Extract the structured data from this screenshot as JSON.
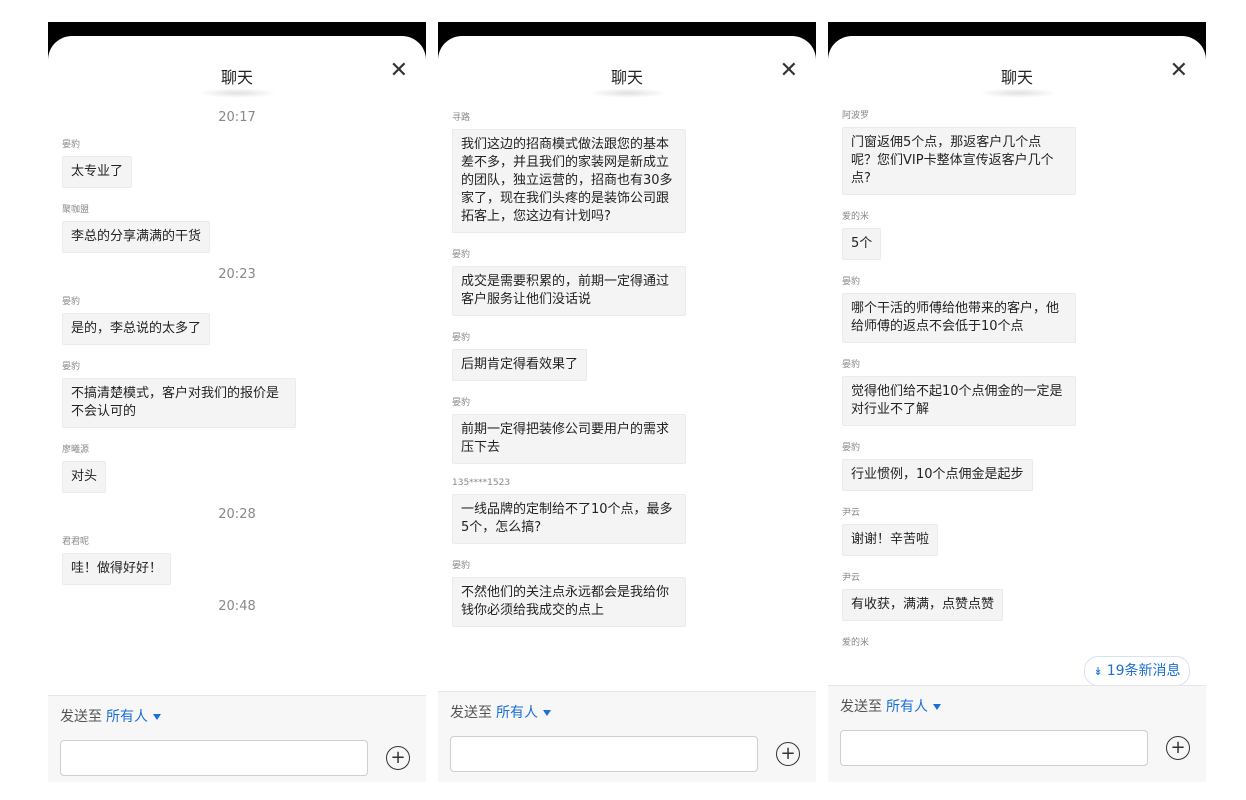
{
  "panels": [
    {
      "title": "聊天",
      "close": "✕",
      "items": [
        {
          "type": "time",
          "text": "20:17"
        },
        {
          "type": "msg",
          "sender": "晏豹",
          "text": "太专业了"
        },
        {
          "type": "msg",
          "sender": "聚咖盟",
          "text": "李总的分享满满的干货"
        },
        {
          "type": "time",
          "text": "20:23"
        },
        {
          "type": "msg",
          "sender": "晏豹",
          "text": "是的，李总说的太多了"
        },
        {
          "type": "msg",
          "sender": "晏豹",
          "text": "不搞清楚模式，客户对我们的报价是不会认可的"
        },
        {
          "type": "msg",
          "sender": "廖曦源",
          "text": "对头"
        },
        {
          "type": "time",
          "text": "20:28"
        },
        {
          "type": "msg",
          "sender": "君君呢",
          "text": "哇！做得好好！"
        },
        {
          "type": "time",
          "text": "20:48"
        }
      ],
      "send_to_label": "发送至",
      "recipient": "所有人",
      "plus": "+"
    },
    {
      "title": "聊天",
      "close": "✕",
      "items": [
        {
          "type": "msg",
          "sender": "寻路",
          "text": "我们这边的招商模式做法跟您的基本差不多，并且我们的家装网是新成立的团队，独立运营的，招商也有30多家了，现在我们头疼的是装饰公司跟拓客上，您这边有计划吗?"
        },
        {
          "type": "msg",
          "sender": "晏豹",
          "text": "成交是需要积累的，前期一定得通过客户服务让他们没话说"
        },
        {
          "type": "msg",
          "sender": "晏豹",
          "text": "后期肯定得看效果了"
        },
        {
          "type": "msg",
          "sender": "晏豹",
          "text": "前期一定得把装修公司要用户的需求压下去"
        },
        {
          "type": "msg",
          "sender": "135****1523",
          "text": "一线品牌的定制给不了10个点，最多5个，怎么搞?"
        },
        {
          "type": "msg",
          "sender": "晏豹",
          "text": "不然他们的关注点永远都会是我给你钱你必须给我成交的点上"
        }
      ],
      "send_to_label": "发送至",
      "recipient": "所有人",
      "plus": "+"
    },
    {
      "title": "聊天",
      "close": "✕",
      "items": [
        {
          "type": "msg",
          "sender": "阿波罗",
          "text": "门窗返佣5个点，那返客户几个点呢？您们VIP卡整体宣传返客户几个点?"
        },
        {
          "type": "msg",
          "sender": "爱的米",
          "text": "5个"
        },
        {
          "type": "msg",
          "sender": "晏豹",
          "text": "哪个干活的师傅给他带来的客户，他给师傅的返点不会低于10个点"
        },
        {
          "type": "msg",
          "sender": "晏豹",
          "text": "觉得他们给不起10个点佣金的一定是对行业不了解"
        },
        {
          "type": "msg",
          "sender": "晏豹",
          "text": "行业惯例，10个点佣金是起步"
        },
        {
          "type": "msg",
          "sender": "尹云",
          "text": "谢谢！辛苦啦"
        },
        {
          "type": "msg",
          "sender": "尹云",
          "text": "有收获，满满，点赞点赞"
        },
        {
          "type": "msg",
          "sender": "爱的米",
          "text": ""
        }
      ],
      "send_to_label": "发送至",
      "recipient": "所有人",
      "plus": "+",
      "new_messages": "19条新消息",
      "new_messages_icon": "double-chevron-down-icon"
    }
  ]
}
